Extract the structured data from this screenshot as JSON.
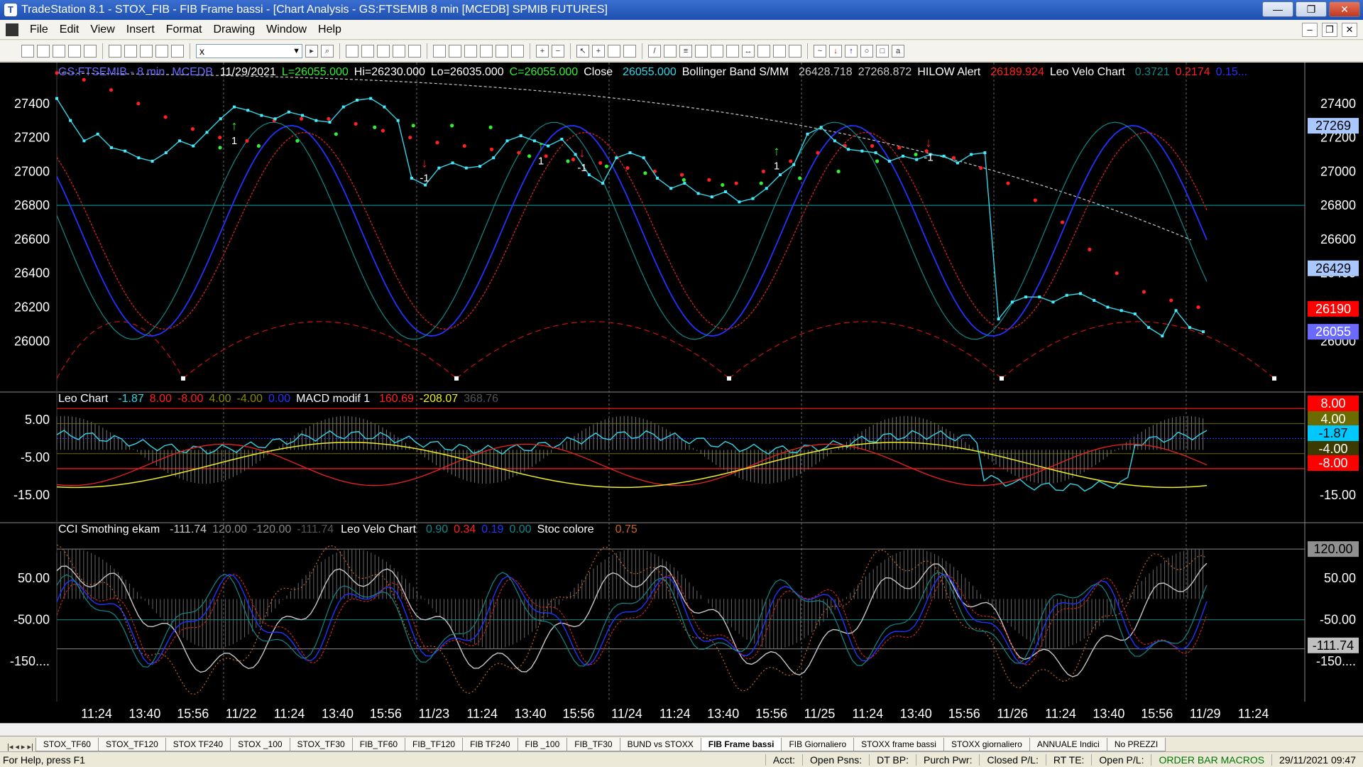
{
  "window": {
    "title": "TradeStation 8.1 - STOX_FIB - FIB Frame bassi - [Chart Analysis - GS:FTSEMIB  8 min  [MCEDB] SPMIB FUTURES]",
    "minimize": "—",
    "maximize": "❐",
    "close": "✕"
  },
  "menu": [
    "File",
    "Edit",
    "View",
    "Insert",
    "Format",
    "Drawing",
    "Window",
    "Help"
  ],
  "toolbar": {
    "symbol_value": "x"
  },
  "chart_data": {
    "type": "line",
    "header": {
      "symbol": "GS:FTSEMIB - 8 min",
      "feed": "MCEDB",
      "date": "11/29/2021",
      "low_last": "L=26055.000",
      "hi": "Hi=26230.000",
      "lo": "Lo=26035.000",
      "close_val": "C=26055.000",
      "close_label": "Close",
      "close_num": "26055.000",
      "bb_label": "Bollinger Band S/MM",
      "bb1": "26428.718",
      "bb2": "27268.872",
      "hilow_label": "HILOW Alert",
      "hilow_val": "26189.924",
      "leo_label": "Leo Velo Chart",
      "leo1": "0.3721",
      "leo2": "0.2174",
      "leo3": "0.15..."
    },
    "price_axis": {
      "ticks": [
        "27400",
        "27200",
        "27000",
        "26800",
        "26600",
        "26400",
        "26200",
        "26000"
      ],
      "ylim": [
        25750,
        27600
      ],
      "markers": [
        {
          "label": "27269",
          "bg": "#a8c8ff",
          "fg": "#000"
        },
        {
          "label": "26429",
          "bg": "#a8c8ff",
          "fg": "#000"
        },
        {
          "label": "26190",
          "bg": "#ff0000",
          "fg": "#fff"
        },
        {
          "label": "26055",
          "bg": "#6a6aff",
          "fg": "#fff"
        }
      ]
    },
    "leo_pane": {
      "title": "Leo Chart",
      "v1": "-1.87",
      "v2": "8.00",
      "v3": "-8.00",
      "v4": "4.00",
      "v5": "-4.00",
      "v6": "0.00",
      "macd_label": "MACD modif 1",
      "m1": "160.69",
      "m2": "-208.07",
      "m3": "368.76",
      "ticks": [
        "5.00",
        "-5.00",
        "-15.00"
      ],
      "ylim": [
        -22,
        12
      ],
      "markers": [
        {
          "label": "8.00",
          "bg": "#ff0000",
          "fg": "#fff"
        },
        {
          "label": "4.00",
          "bg": "#6b6b00",
          "fg": "#fff"
        },
        {
          "label": "-1.87",
          "bg": "#00c8ff",
          "fg": "#000"
        },
        {
          "label": "-4.00",
          "bg": "#3b3b00",
          "fg": "#fff"
        },
        {
          "label": "-8.00",
          "bg": "#ff0000",
          "fg": "#fff"
        }
      ]
    },
    "cci_pane": {
      "title": "CCI Smothing ekam",
      "c1": "-111.74",
      "c2": "120.00",
      "c3": "-120.00",
      "c4": "-111.74",
      "leo_label": "Leo Velo Chart",
      "l1": "0.90",
      "l2": "0.34",
      "l3": "0.19",
      "l4": "0.00",
      "stoc_label": "Stoc colore",
      "s1": "0.75",
      "ticks": [
        "50.00",
        "-50.00",
        "-150...."
      ],
      "ylim": [
        -230,
        180
      ],
      "markers": [
        {
          "label": "120.00",
          "bg": "#909090",
          "fg": "#000"
        },
        {
          "label": "-111.74",
          "bg": "#c0c0c0",
          "fg": "#000"
        }
      ]
    },
    "time_axis": [
      "11:24",
      "13:40",
      "15:56",
      "11/22",
      "11:24",
      "13:40",
      "15:56",
      "11/23",
      "11:24",
      "13:40",
      "15:56",
      "11/24",
      "11:24",
      "13:40",
      "15:56",
      "11/25",
      "11:24",
      "13:40",
      "15:56",
      "11/26",
      "11:24",
      "13:40",
      "15:56",
      "11/29",
      "11:24"
    ],
    "close_series": [
      27430,
      27300,
      27180,
      27220,
      27140,
      27120,
      27080,
      27060,
      27110,
      27180,
      27150,
      27230,
      27310,
      27380,
      27360,
      27330,
      27310,
      27350,
      27330,
      27300,
      27290,
      27380,
      27420,
      27430,
      27380,
      27300,
      26960,
      26920,
      27020,
      27050,
      27020,
      27030,
      27080,
      27180,
      27210,
      27180,
      27150,
      27190,
      27100,
      26980,
      26930,
      27080,
      27110,
      27080,
      26960,
      26900,
      26930,
      26870,
      26850,
      26880,
      26820,
      26840,
      26900,
      26980,
      27040,
      27220,
      27260,
      27180,
      27130,
      27120,
      27110,
      27060,
      27090,
      27070,
      27100,
      27090,
      27050,
      27100,
      27110,
      26130,
      26230,
      26260,
      26260,
      26230,
      26270,
      26280,
      26240,
      26200,
      26180,
      26160,
      26080,
      26030,
      26180,
      26080,
      26055
    ],
    "hilow_red": [
      27580,
      27540,
      27480,
      27400,
      27320,
      27250,
      27200,
      27180,
      27300,
      27310,
      27310,
      27280,
      27240,
      27200,
      27170,
      27150,
      27130,
      27110,
      27090,
      27070,
      27050,
      27020,
      27000,
      26980,
      26950,
      26930,
      27000,
      27060,
      27110,
      27150,
      27150,
      27140,
      27120,
      27080,
      27020,
      26930,
      26830,
      26700,
      26540,
      26400,
      26290,
      26240,
      26200
    ],
    "hilow_green": [
      27140,
      27150,
      27180,
      27220,
      27260,
      27270,
      27270,
      27260,
      27090,
      27060,
      27030,
      26990,
      26950,
      26920,
      26930,
      26960,
      27000,
      27060,
      27100
    ]
  },
  "tabs": [
    "STOX_TF60",
    "STOX_TF120",
    "STOX TF240",
    "STOX _100",
    "STOX_TF30",
    "FIB_TF60",
    "FIB_TF120",
    "FIB TF240",
    "FIB _100",
    "FIB_TF30",
    "BUND vs STOXX",
    "FIB Frame bassi",
    "FIB Giornaliero",
    "STOXX frame bassi",
    "STOXX giornaliero",
    "ANNUALE Indici",
    "No PREZZI"
  ],
  "active_tab": "FIB Frame bassi",
  "status": {
    "help": "For Help, press F1",
    "acct": "Acct:",
    "open_psns": "Open Psns:",
    "dtbp": "DT BP:",
    "purch": "Purch Pwr:",
    "closed": "Closed P/L:",
    "rtte": "RT TE:",
    "openpl": "Open P/L:",
    "macros": "ORDER BAR MACROS",
    "datetime": "29/11/2021 09:47"
  }
}
